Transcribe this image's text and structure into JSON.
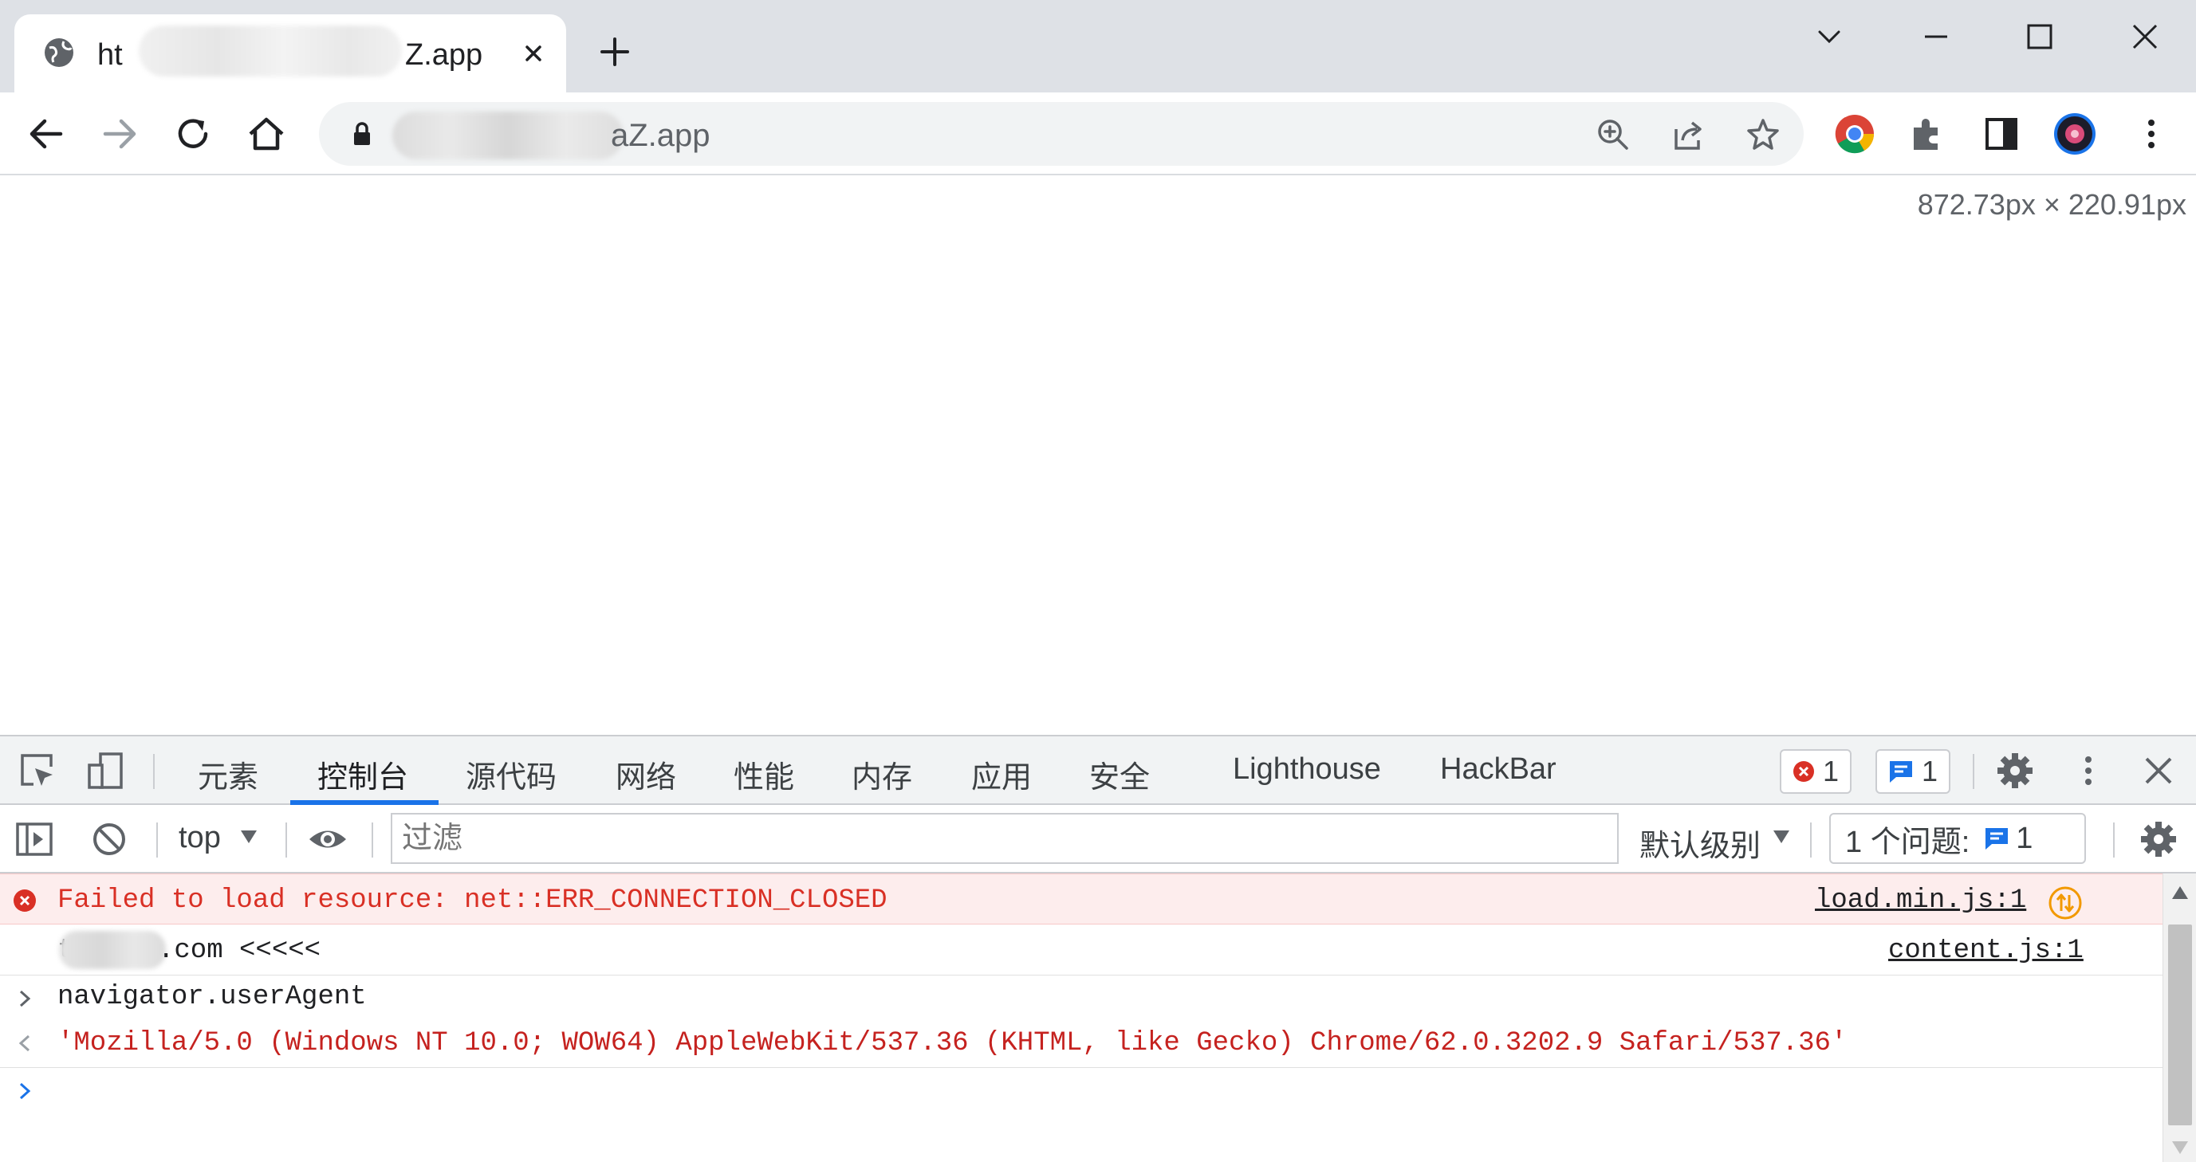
{
  "browser": {
    "tab": {
      "title_prefix": "ht",
      "title_suffix": "Z.app",
      "favicon": "globe-icon"
    },
    "url_visible": "aZ.app",
    "window_controls": [
      "chevron-down-icon",
      "minimize-icon",
      "maximize-icon",
      "close-icon"
    ]
  },
  "viewport": {
    "dimensions_label": "872.73px × 220.91px"
  },
  "devtools": {
    "tabs": [
      {
        "label": "元素"
      },
      {
        "label": "控制台"
      },
      {
        "label": "源代码"
      },
      {
        "label": "网络"
      },
      {
        "label": "性能"
      },
      {
        "label": "内存"
      },
      {
        "label": "应用"
      },
      {
        "label": "安全"
      },
      {
        "label": "Lighthouse"
      },
      {
        "label": "HackBar"
      }
    ],
    "active_tab": "控制台",
    "error_count": "1",
    "message_count": "1",
    "toolbar": {
      "context": "top",
      "filter_placeholder": "过滤",
      "level": "默认级别",
      "issues_label": "1 个问题:",
      "issues_count": "1"
    },
    "console": {
      "error": {
        "text": "Failed to load resource: net::ERR_CONNECTION_CLOSED",
        "source": "load.min.js:1"
      },
      "log": {
        "text_prefix": "t",
        "text": ".com <<<<<",
        "source": "content.js:1"
      },
      "command": "navigator.userAgent",
      "result": "'Mozilla/5.0 (Windows NT 10.0; WOW64) AppleWebKit/537.36 (KHTML, like Gecko) Chrome/62.0.3202.9 Safari/537.36'"
    },
    "colors": {
      "accent": "#1a73e8",
      "error": "#d93025",
      "error_bg": "#fdeded"
    }
  }
}
